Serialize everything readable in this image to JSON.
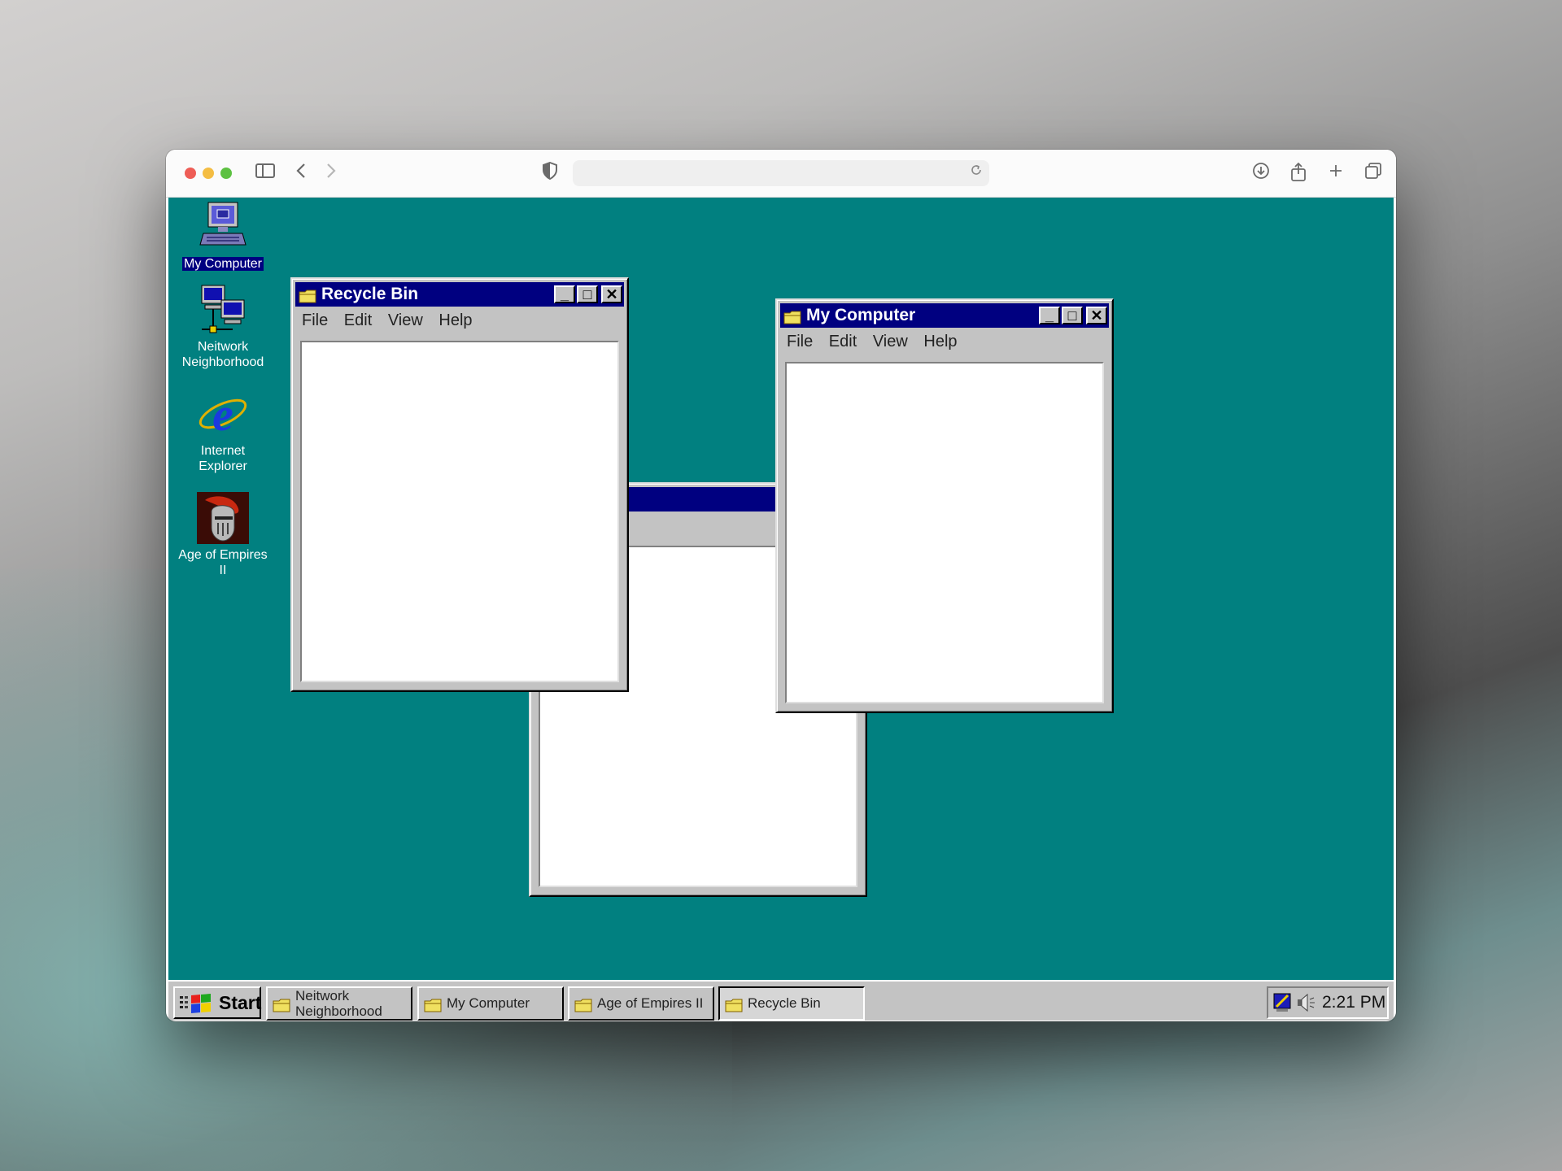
{
  "browser": {
    "url": "",
    "toolbar_icons": [
      "sidebar-icon",
      "back-icon",
      "forward-icon",
      "privacy-shield-icon",
      "download-icon",
      "share-icon",
      "new-tab-icon",
      "tabs-overview-icon"
    ]
  },
  "desktop": {
    "background_color": "#018080",
    "icons": [
      {
        "label": "My Computer",
        "icon": "computer-icon",
        "selected": true
      },
      {
        "label": "Neitwork Neighborhood",
        "icon": "network-icon"
      },
      {
        "label": "Internet Explorer",
        "icon": "internet-explorer-icon"
      },
      {
        "label": "Age of Empires II",
        "icon": "age-of-empires-icon"
      }
    ]
  },
  "windows": {
    "recycle_bin": {
      "title": "Recycle Bin",
      "menu": [
        "File",
        "Edit",
        "View",
        "Help"
      ]
    },
    "my_computer": {
      "title": "My Computer",
      "menu": [
        "File",
        "Edit",
        "View",
        "Help"
      ]
    },
    "untitled": {
      "title": ""
    }
  },
  "taskbar": {
    "start_label": "Start",
    "items": [
      {
        "label_line1": "Neitwork",
        "label_line2": "Neighborhood",
        "active": false
      },
      {
        "label": "My Computer",
        "active": false
      },
      {
        "label": "Age of Empires II",
        "active": false
      },
      {
        "label": "Recycle Bin",
        "active": true
      }
    ],
    "clock": "2:21 PM"
  }
}
